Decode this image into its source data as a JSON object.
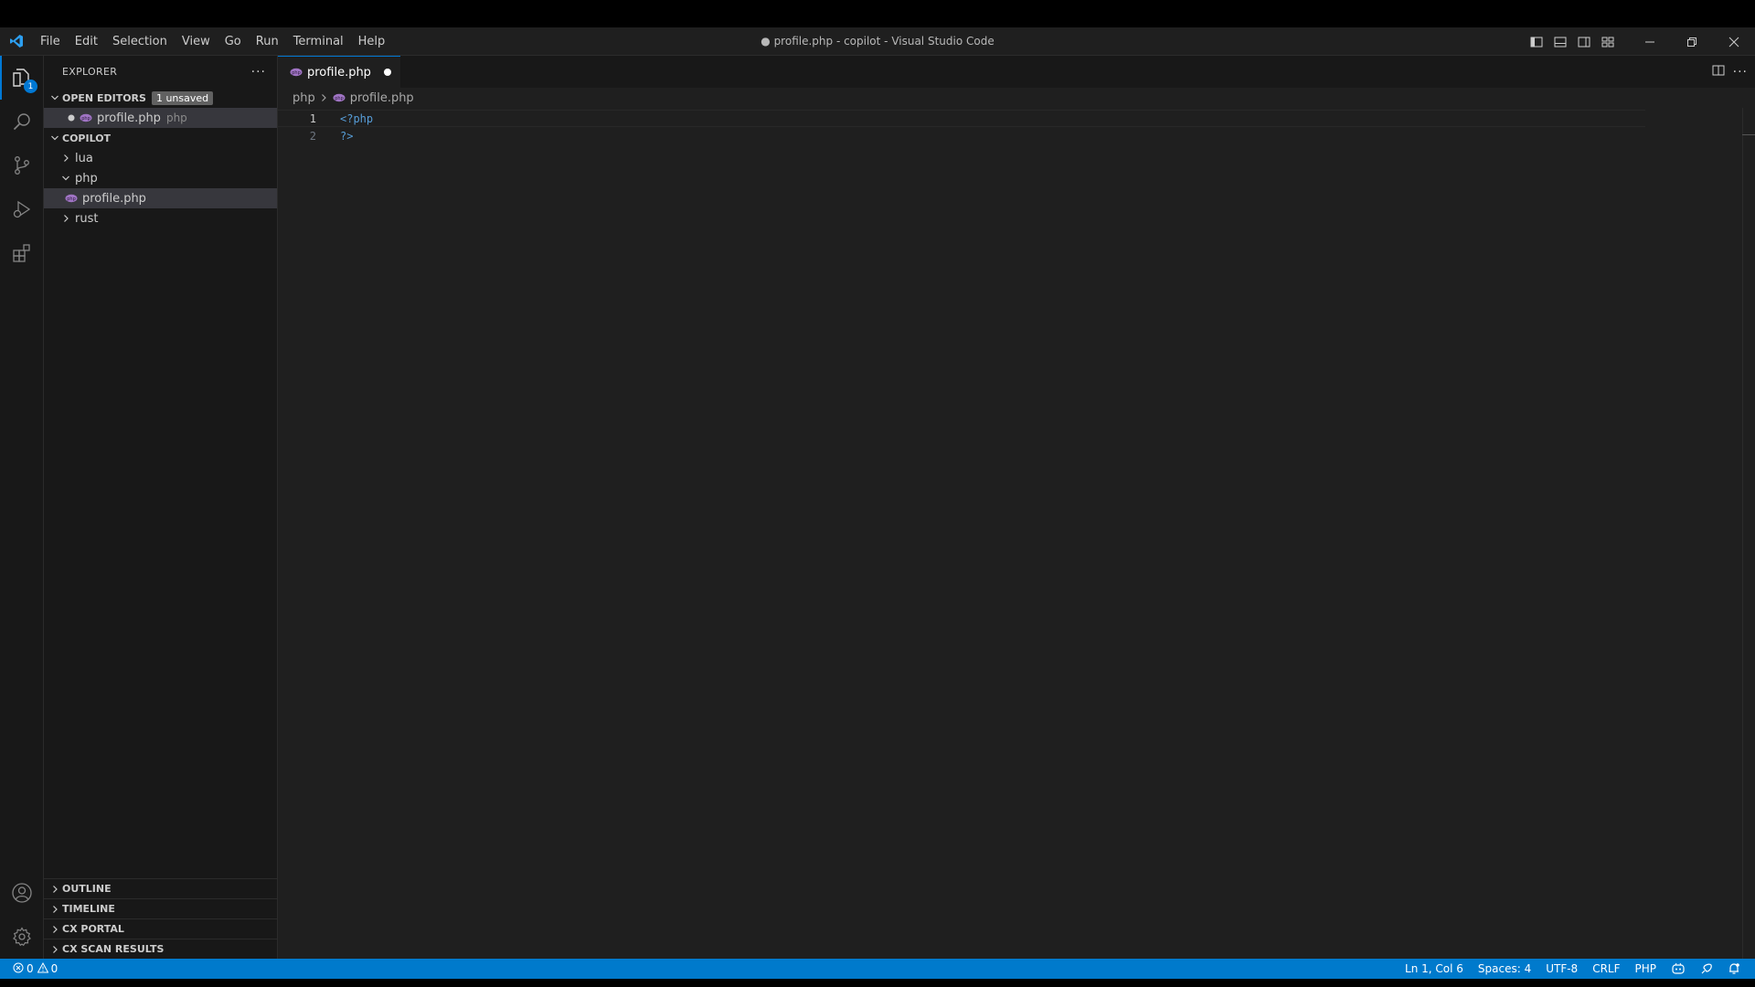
{
  "window": {
    "title": "● profile.php - copilot - Visual Studio Code",
    "accent": "#0078d4",
    "statusbar_color": "#007acc"
  },
  "menu": [
    "File",
    "Edit",
    "Selection",
    "View",
    "Go",
    "Run",
    "Terminal",
    "Help"
  ],
  "activitybar": {
    "explorer_badge": "1"
  },
  "sidebar": {
    "title": "EXPLORER",
    "open_editors": {
      "label": "OPEN EDITORS",
      "badge": "1 unsaved",
      "items": [
        {
          "name": "profile.php",
          "folder": "php"
        }
      ]
    },
    "workspace": {
      "label": "COPILOT",
      "tree": [
        {
          "name": "lua"
        },
        {
          "name": "php"
        },
        {
          "name": "profile.php"
        },
        {
          "name": "rust"
        }
      ]
    },
    "bottom_sections": [
      "OUTLINE",
      "TIMELINE",
      "CX PORTAL",
      "CX SCAN RESULTS"
    ]
  },
  "editor": {
    "tab": {
      "label": "profile.php"
    },
    "breadcrumb": [
      "php",
      "profile.php"
    ],
    "lines": [
      {
        "num": "1",
        "text": "<?php"
      },
      {
        "num": "2",
        "text": "?>"
      }
    ]
  },
  "status": {
    "errors": "0",
    "warnings": "0",
    "position": "Ln 1, Col 6",
    "spaces": "Spaces: 4",
    "encoding": "UTF-8",
    "eol": "CRLF",
    "language": "PHP"
  }
}
